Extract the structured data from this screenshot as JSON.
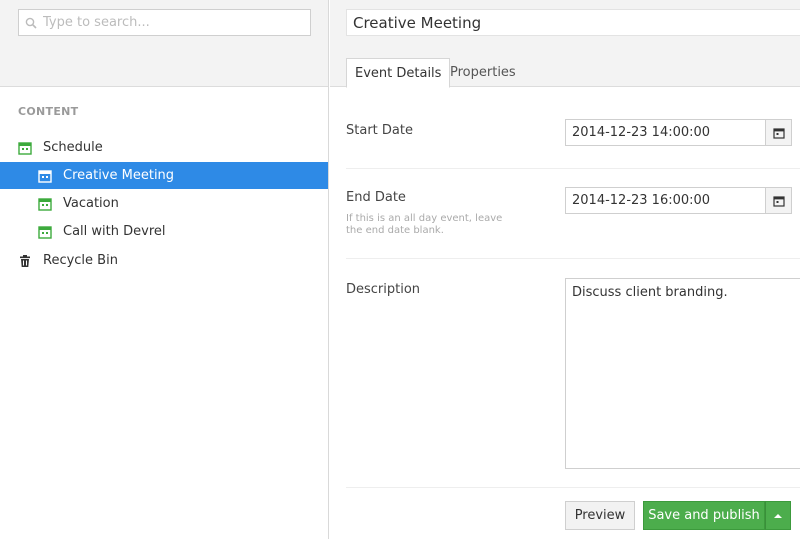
{
  "search": {
    "placeholder": "Type to search..."
  },
  "tree": {
    "section_label": "CONTENT",
    "items": [
      {
        "label": "Schedule",
        "icon": "calendar-icon"
      },
      {
        "label": "Creative Meeting",
        "icon": "calendar-icon",
        "selected": true
      },
      {
        "label": "Vacation",
        "icon": "calendar-icon"
      },
      {
        "label": "Call with Devrel",
        "icon": "calendar-icon"
      },
      {
        "label": "Recycle Bin",
        "icon": "trash-icon"
      }
    ]
  },
  "editor": {
    "title": "Creative Meeting",
    "tabs": [
      {
        "label": "Event Details"
      },
      {
        "label": "Properties"
      }
    ],
    "fields": {
      "start_date": {
        "label": "Start Date",
        "value": "2014-12-23 14:00:00"
      },
      "end_date": {
        "label": "End Date",
        "value": "2014-12-23 16:00:00",
        "help": "If this is an all day event, leave the end date blank."
      },
      "description": {
        "label": "Description",
        "value": "Discuss client branding."
      }
    },
    "actions": {
      "preview_label": "Preview",
      "publish_label": "Save and publish"
    }
  },
  "colors": {
    "selected_bg": "#2e8ae6",
    "publish_green": "#4cad4c",
    "icon_green": "#3daa3d"
  }
}
